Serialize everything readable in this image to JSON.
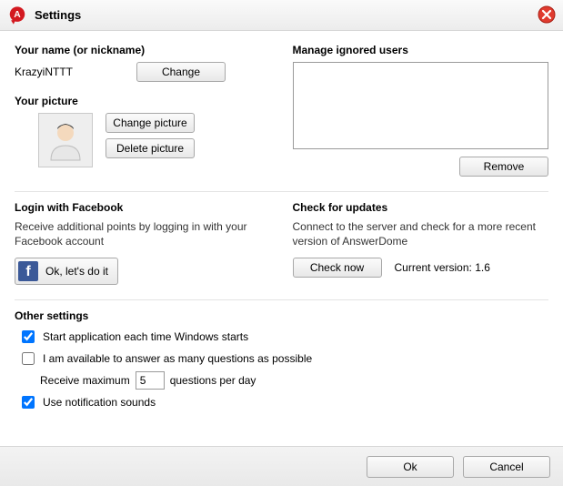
{
  "window": {
    "title": "Settings"
  },
  "name_section": {
    "heading": "Your name (or nickname)",
    "value": "KrazyiNTTT",
    "change_btn": "Change"
  },
  "picture_section": {
    "heading": "Your picture",
    "change_btn": "Change picture",
    "delete_btn": "Delete picture"
  },
  "ignored_section": {
    "heading": "Manage ignored users",
    "remove_btn": "Remove"
  },
  "facebook_section": {
    "heading": "Login with Facebook",
    "subtext": "Receive additional points by logging in with your Facebook account",
    "btn_label": "Ok, let's do it"
  },
  "updates_section": {
    "heading": "Check for updates",
    "subtext": "Connect to the server and check for a more recent version of AnswerDome",
    "check_btn": "Check now",
    "version_text": "Current version: 1.6"
  },
  "other_section": {
    "heading": "Other settings",
    "opt_start": {
      "label": "Start application each time Windows starts",
      "checked": true
    },
    "opt_available": {
      "label": "I am available to answer as many questions as possible",
      "checked": false
    },
    "maxq_prefix": "Receive maximum",
    "maxq_value": "5",
    "maxq_suffix": "questions per day",
    "opt_sounds": {
      "label": "Use notification sounds",
      "checked": true
    }
  },
  "footer": {
    "ok": "Ok",
    "cancel": "Cancel"
  }
}
